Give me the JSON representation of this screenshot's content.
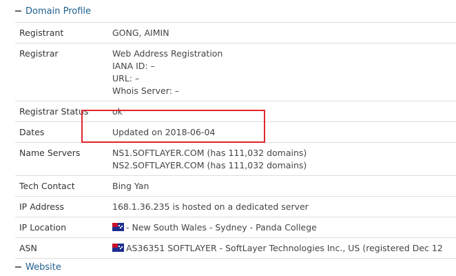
{
  "domain_profile": {
    "title": "Domain Profile",
    "rows": [
      {
        "key": "Registrant",
        "lines": [
          "GONG, AIMIN"
        ]
      },
      {
        "key": "Registrar",
        "lines": [
          "Web Address Registration",
          "IANA ID: –",
          "URL: –",
          "Whois Server: –"
        ]
      },
      {
        "key": "Registrar Status",
        "lines": [
          "ok"
        ]
      },
      {
        "key": "Dates",
        "lines": [
          "Updated on 2018-06-04"
        ]
      },
      {
        "key": "Name Servers",
        "lines": [
          "NS1.SOFTLAYER.COM (has 111,032 domains)",
          "NS2.SOFTLAYER.COM (has 111,032 domains)"
        ]
      },
      {
        "key": "Tech Contact",
        "lines": [
          "Bing Yan"
        ]
      },
      {
        "key": "IP Address",
        "lines": [
          "168.1.36.235 is hosted on a dedicated server"
        ]
      },
      {
        "key": "IP Location",
        "lines": [
          "- New South Wales - Sydney - Panda College"
        ]
      },
      {
        "key": "ASN",
        "lines": [
          "AS36351 SOFTLAYER - SoftLayer Technologies Inc., US (registered Dec 12"
        ]
      }
    ]
  },
  "website": {
    "title": "Website"
  },
  "icons": {
    "collapse": "minus-icon",
    "flag": "australia-flag-icon"
  },
  "colors": {
    "header_link": "#1e5e8c",
    "highlight": "#e0252b"
  }
}
